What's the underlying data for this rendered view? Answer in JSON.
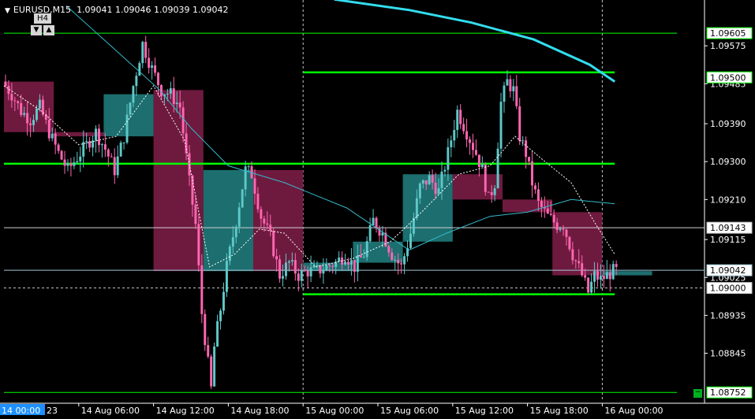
{
  "header": {
    "symbol_label": "EURUSD,M15",
    "ohlc": "1.09041 1.09046 1.09039 1.09042"
  },
  "tf_panel": {
    "label": "H4",
    "down_icon": "triangle-down-icon",
    "up_icon": "triangle-up-icon"
  },
  "colors": {
    "background": "#000000",
    "bull_candle": "#5ec8c8",
    "bear_candle": "#ff66b2",
    "bull_box": "#1d6e6e",
    "bear_box": "#6e1a3e",
    "level_line": "#00ff00",
    "ma_slow": "#33ddee",
    "ma_mid": "#33bbcc",
    "ma_fast": "#ffffff",
    "bid_line": "#a0c8d8",
    "grid_dashed": "#c8c8c8",
    "axis_text": "#ffffff"
  },
  "x_axis": {
    "corner_label": "14 00:00",
    "corner_tail": "23",
    "ticks": [
      "14 Aug 06:00",
      "14 Aug 12:00",
      "14 Aug 18:00",
      "15 Aug 00:00",
      "15 Aug 06:00",
      "15 Aug 12:00",
      "15 Aug 18:00",
      "16 Aug 00:00"
    ]
  },
  "y_axis": {
    "ticks": [
      "1.09575",
      "1.09485",
      "1.09390",
      "1.09300",
      "1.09210",
      "1.09115",
      "1.09025",
      "1.08935",
      "1.08845"
    ],
    "marked_levels": [
      {
        "label": "1.09605",
        "value": 1.09605,
        "kind": "level"
      },
      {
        "label": "1.09500",
        "value": 1.095,
        "kind": "level"
      },
      {
        "label": "1.09143",
        "value": 1.09143,
        "kind": "horizontal"
      },
      {
        "label": "1.09042",
        "value": 1.09042,
        "kind": "bid"
      },
      {
        "label": "1.09000",
        "value": 1.09,
        "kind": "dashed"
      },
      {
        "label": "1.08752",
        "value": 1.08752,
        "kind": "level"
      }
    ]
  },
  "chart_data": {
    "type": "candlestick",
    "symbol": "EURUSD",
    "timeframe": "M15",
    "overlay_timeframe": "H4",
    "ylim": [
      1.0873,
      1.0968
    ],
    "bar_range": [
      0,
      216
    ],
    "x_labels": [
      {
        "index": 0,
        "label": "14 00:00"
      },
      {
        "index": 24,
        "label": "14 Aug 06:00"
      },
      {
        "index": 48,
        "label": "14 Aug 12:00"
      },
      {
        "index": 72,
        "label": "14 Aug 18:00"
      },
      {
        "index": 96,
        "label": "15 Aug 00:00"
      },
      {
        "index": 120,
        "label": "15 Aug 06:00"
      },
      {
        "index": 144,
        "label": "15 Aug 12:00"
      },
      {
        "index": 168,
        "label": "15 Aug 18:00"
      },
      {
        "index": 192,
        "label": "16 Aug 00:00"
      }
    ],
    "price_path": [
      [
        0,
        1.0949
      ],
      [
        3,
        1.0946
      ],
      [
        6,
        1.0942
      ],
      [
        9,
        1.094
      ],
      [
        12,
        1.0943
      ],
      [
        15,
        1.0937
      ],
      [
        18,
        1.0932
      ],
      [
        21,
        1.0928
      ],
      [
        24,
        1.0931
      ],
      [
        27,
        1.0934
      ],
      [
        30,
        1.0937
      ],
      [
        33,
        1.0933
      ],
      [
        36,
        1.0928
      ],
      [
        39,
        1.0936
      ],
      [
        42,
        1.0948
      ],
      [
        45,
        1.0958
      ],
      [
        48,
        1.0952
      ],
      [
        51,
        1.0947
      ],
      [
        54,
        1.0946
      ],
      [
        57,
        1.0943
      ],
      [
        60,
        1.0925
      ],
      [
        62,
        1.0915
      ],
      [
        64,
        1.0894
      ],
      [
        65,
        1.0888
      ],
      [
        66,
        1.0882
      ],
      [
        67,
        1.0876
      ],
      [
        68,
        1.0886
      ],
      [
        70,
        1.0895
      ],
      [
        72,
        1.0905
      ],
      [
        75,
        1.0916
      ],
      [
        78,
        1.0928
      ],
      [
        80,
        1.0927
      ],
      [
        83,
        1.0917
      ],
      [
        86,
        1.0912
      ],
      [
        89,
        1.0903
      ],
      [
        92,
        1.0906
      ],
      [
        95,
        1.0903
      ],
      [
        98,
        1.0904
      ],
      [
        101,
        1.0904
      ],
      [
        104,
        1.0905
      ],
      [
        107,
        1.0906
      ],
      [
        110,
        1.0908
      ],
      [
        113,
        1.0905
      ],
      [
        116,
        1.0908
      ],
      [
        119,
        1.0916
      ],
      [
        122,
        1.0913
      ],
      [
        125,
        1.0908
      ],
      [
        128,
        1.0905
      ],
      [
        131,
        1.0913
      ],
      [
        134,
        1.0924
      ],
      [
        137,
        1.0926
      ],
      [
        140,
        1.0923
      ],
      [
        143,
        1.0932
      ],
      [
        146,
        1.0942
      ],
      [
        149,
        1.0937
      ],
      [
        152,
        1.0932
      ],
      [
        154,
        1.0928
      ],
      [
        156,
        1.0921
      ],
      [
        158,
        1.0925
      ],
      [
        160,
        1.0944
      ],
      [
        162,
        1.0949
      ],
      [
        164,
        1.0947
      ],
      [
        166,
        1.0936
      ],
      [
        168,
        1.0932
      ],
      [
        170,
        1.0925
      ],
      [
        172,
        1.092
      ],
      [
        175,
        1.0917
      ],
      [
        178,
        1.0915
      ],
      [
        180,
        1.0915
      ],
      [
        183,
        1.0908
      ],
      [
        186,
        1.0903
      ],
      [
        188,
        1.0899
      ],
      [
        190,
        1.0903
      ],
      [
        192,
        1.0902
      ],
      [
        194,
        1.0903
      ],
      [
        196,
        1.0904
      ]
    ],
    "h4_boxes": [
      {
        "from": 0,
        "to": 15,
        "open": 1.0949,
        "close": 1.0937,
        "low": 1.0926,
        "high": 1.0952
      },
      {
        "from": 16,
        "to": 31,
        "open": 1.0937,
        "close": 1.0936,
        "low": 1.0926,
        "high": 1.0943
      },
      {
        "from": 32,
        "to": 47,
        "open": 1.0936,
        "close": 1.0946,
        "low": 1.0928,
        "high": 1.0961
      },
      {
        "from": 48,
        "to": 63,
        "open": 1.0947,
        "close": 1.0904,
        "low": 1.0895,
        "high": 1.095
      },
      {
        "from": 64,
        "to": 79,
        "open": 1.0904,
        "close": 1.0928,
        "low": 1.0875,
        "high": 1.093
      },
      {
        "from": 80,
        "to": 95,
        "open": 1.0928,
        "close": 1.0904,
        "low": 1.0901,
        "high": 1.093
      },
      {
        "from": 96,
        "to": 111,
        "open": 1.0904,
        "close": 1.0906,
        "low": 1.09,
        "high": 1.0908
      },
      {
        "from": 112,
        "to": 127,
        "open": 1.0906,
        "close": 1.0911,
        "low": 1.0903,
        "high": 1.0918
      },
      {
        "from": 128,
        "to": 143,
        "open": 1.0911,
        "close": 1.0927,
        "low": 1.0905,
        "high": 1.0932
      },
      {
        "from": 144,
        "to": 159,
        "open": 1.0927,
        "close": 1.0921,
        "low": 1.0897,
        "high": 1.0952
      },
      {
        "from": 160,
        "to": 175,
        "open": 1.0921,
        "close": 1.0918,
        "low": 1.0913,
        "high": 1.095
      },
      {
        "from": 176,
        "to": 191,
        "open": 1.0918,
        "close": 1.0903,
        "low": 1.0898,
        "high": 1.0921
      },
      {
        "from": 192,
        "to": 207,
        "open": 1.0903,
        "close": 1.0904,
        "low": 1.0901,
        "high": 1.0906
      }
    ],
    "levels": [
      {
        "price": 1.09605,
        "from": 0,
        "to": 216,
        "style": "thin"
      },
      {
        "price": 1.09512,
        "from": 96,
        "to": 196,
        "style": "thick"
      },
      {
        "price": 1.09295,
        "from": 0,
        "to": 196,
        "style": "thick"
      },
      {
        "price": 1.08985,
        "from": 96,
        "to": 196,
        "style": "thick"
      },
      {
        "price": 1.08752,
        "from": 0,
        "to": 216,
        "style": "thin"
      }
    ],
    "horizontal_line": 1.09143,
    "bid": 1.09042,
    "dashed_price": 1.09,
    "ma_slow": [
      [
        106,
        1.09685
      ],
      [
        130,
        1.0966
      ],
      [
        150,
        1.0963
      ],
      [
        170,
        1.0959
      ],
      [
        188,
        1.0953
      ],
      [
        196,
        1.0949
      ]
    ],
    "ma_mid": [
      [
        20,
        1.0967
      ],
      [
        35,
        1.0957
      ],
      [
        50,
        1.0947
      ],
      [
        60,
        1.0938
      ],
      [
        72,
        1.0929
      ],
      [
        90,
        1.0925
      ],
      [
        110,
        1.0919
      ],
      [
        122,
        1.0913
      ],
      [
        130,
        1.0909
      ],
      [
        142,
        1.0913
      ],
      [
        156,
        1.0917
      ],
      [
        168,
        1.0918
      ],
      [
        182,
        1.0921
      ],
      [
        196,
        1.092
      ]
    ],
    "ma_fast": [
      [
        0,
        1.0948
      ],
      [
        12,
        1.0942
      ],
      [
        24,
        1.0934
      ],
      [
        36,
        1.0936
      ],
      [
        48,
        1.0948
      ],
      [
        58,
        1.0935
      ],
      [
        66,
        1.0905
      ],
      [
        74,
        1.0908
      ],
      [
        82,
        1.0914
      ],
      [
        90,
        1.0913
      ],
      [
        100,
        1.0905
      ],
      [
        112,
        1.0907
      ],
      [
        124,
        1.0911
      ],
      [
        134,
        1.0918
      ],
      [
        146,
        1.0927
      ],
      [
        156,
        1.0929
      ],
      [
        164,
        1.0936
      ],
      [
        172,
        1.0931
      ],
      [
        182,
        1.0925
      ],
      [
        190,
        1.0915
      ],
      [
        196,
        1.0908
      ]
    ]
  }
}
